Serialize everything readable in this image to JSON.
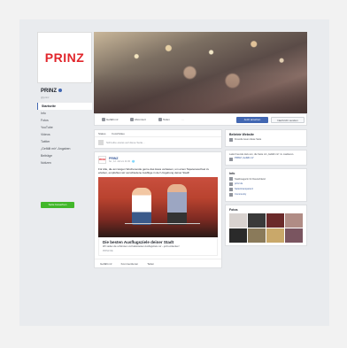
{
  "page": {
    "logo_text": "PRINZ",
    "name": "PRINZ",
    "handle": "@prinz",
    "nav": [
      "Startseite",
      "Info",
      "Fotos",
      "YouTube",
      "Videos",
      "Twitter",
      "„Gefällt mir“-Angaben",
      "Beiträge",
      "Notizen"
    ],
    "promote_label": "Seite bewerben"
  },
  "actionbar": {
    "like": "Gefällt mir",
    "follow": "Abonniert",
    "share": "Teilen",
    "more": "···",
    "primary_button": "Jetzt ansehen",
    "message_button": "Nachricht senden"
  },
  "composer": {
    "tab_status": "Status",
    "tab_photo": "Foto/Video",
    "placeholder": "Schreibe etwas auf diese Seite..."
  },
  "post": {
    "author": "PRINZ",
    "time": "So., 12. Juli um 11:00 · 🌐",
    "text": "Für Alle, die am langen Wochenende gerne das Haus verlassen, um einen Tapetenwechsel zu erleben, empfehlen wir verschiedene Ausflüge in der Umgebung deiner Stadt!",
    "link_title": "Die besten Ausflugsziele deiner Stadt",
    "link_desc": "Wir stellen die schönsten und beliebtesten Ausflugsziele vor – jetzt entdecken!",
    "link_source": "PRINZ.DE",
    "like": "Gefällt mir",
    "comment": "Kommentieren",
    "share": "Teilen"
  },
  "sidebar": {
    "suggested_header": "Beliebte Website",
    "suggested_item": "Freunde lesen diese Seite",
    "invite_text": "Lade Freunde dazu ein, die Seite mit „Gefällt mir“ zu markieren.",
    "invite_link": "PRINZ „Gefällt mir“",
    "info_header": "Info",
    "info_items": [
      "Stadtmagazin für Deutschland",
      "prinz.de",
      "Seitentransparenz",
      "Community"
    ],
    "photos_header": "Fotos"
  },
  "colors": {
    "brand_red": "#e1252b",
    "fb_blue": "#4267b2",
    "green": "#42b72a"
  }
}
